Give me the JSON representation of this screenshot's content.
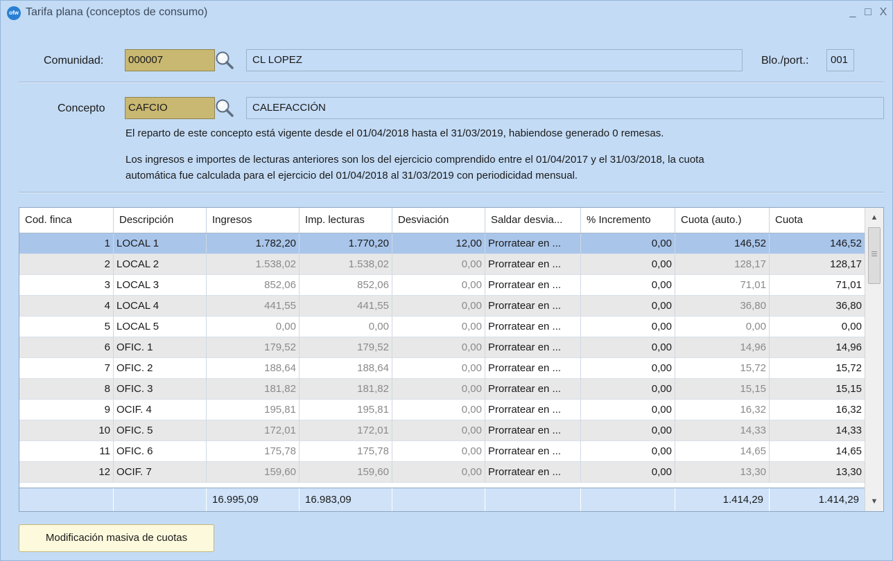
{
  "window": {
    "title": "Tarifa plana (conceptos de consumo)",
    "app_icon_text": "ofw",
    "controls": {
      "minimize": "_",
      "maximize": "□",
      "close": "X"
    }
  },
  "comunidad": {
    "label": "Comunidad:",
    "code": "000007",
    "name": "CL LOPEZ",
    "bloque_label": "Blo./port.:",
    "bloque_value": "001"
  },
  "concepto": {
    "label": "Concepto",
    "code": "CAFCIO",
    "name": "CALEFACCIÓN"
  },
  "info": {
    "line1": "El reparto de este concepto está vigente desde el 01/04/2018 hasta el 31/03/2019, habiendose generado 0 remesas.",
    "line2": "Los ingresos e importes de lecturas anteriores son los del ejercicio comprendido entre el 01/04/2017 y el 31/03/2018, la cuota",
    "line3": "automática fue calculada para el ejercicio del 01/04/2018 al 31/03/2019 con periodicidad mensual."
  },
  "grid": {
    "columns": [
      "Cod. finca",
      "Descripción",
      "Ingresos",
      "Imp. lecturas",
      "Desviación",
      "Saldar desvia...",
      "% Incremento",
      "Cuota (auto.)",
      "Cuota"
    ],
    "rows": [
      {
        "cod": "1",
        "desc": "LOCAL 1",
        "ing": "1.782,20",
        "imp": "1.770,20",
        "desv": "12,00",
        "saldar": "Prorratear en ...",
        "inc": "0,00",
        "auto": "146,52",
        "cuota": "146,52"
      },
      {
        "cod": "2",
        "desc": "LOCAL 2",
        "ing": "1.538,02",
        "imp": "1.538,02",
        "desv": "0,00",
        "saldar": "Prorratear en ...",
        "inc": "0,00",
        "auto": "128,17",
        "cuota": "128,17"
      },
      {
        "cod": "3",
        "desc": "LOCAL 3",
        "ing": "852,06",
        "imp": "852,06",
        "desv": "0,00",
        "saldar": "Prorratear en ...",
        "inc": "0,00",
        "auto": "71,01",
        "cuota": "71,01"
      },
      {
        "cod": "4",
        "desc": "LOCAL 4",
        "ing": "441,55",
        "imp": "441,55",
        "desv": "0,00",
        "saldar": "Prorratear en ...",
        "inc": "0,00",
        "auto": "36,80",
        "cuota": "36,80"
      },
      {
        "cod": "5",
        "desc": "LOCAL 5",
        "ing": "0,00",
        "imp": "0,00",
        "desv": "0,00",
        "saldar": "Prorratear en ...",
        "inc": "0,00",
        "auto": "0,00",
        "cuota": "0,00"
      },
      {
        "cod": "6",
        "desc": "OFIC. 1",
        "ing": "179,52",
        "imp": "179,52",
        "desv": "0,00",
        "saldar": "Prorratear en ...",
        "inc": "0,00",
        "auto": "14,96",
        "cuota": "14,96"
      },
      {
        "cod": "7",
        "desc": "OFIC. 2",
        "ing": "188,64",
        "imp": "188,64",
        "desv": "0,00",
        "saldar": "Prorratear en ...",
        "inc": "0,00",
        "auto": "15,72",
        "cuota": "15,72"
      },
      {
        "cod": "8",
        "desc": "OFIC. 3",
        "ing": "181,82",
        "imp": "181,82",
        "desv": "0,00",
        "saldar": "Prorratear en ...",
        "inc": "0,00",
        "auto": "15,15",
        "cuota": "15,15"
      },
      {
        "cod": "9",
        "desc": "OCIF. 4",
        "ing": "195,81",
        "imp": "195,81",
        "desv": "0,00",
        "saldar": "Prorratear en ...",
        "inc": "0,00",
        "auto": "16,32",
        "cuota": "16,32"
      },
      {
        "cod": "10",
        "desc": "OFIC. 5",
        "ing": "172,01",
        "imp": "172,01",
        "desv": "0,00",
        "saldar": "Prorratear en ...",
        "inc": "0,00",
        "auto": "14,33",
        "cuota": "14,33"
      },
      {
        "cod": "11",
        "desc": "OFIC. 6",
        "ing": "175,78",
        "imp": "175,78",
        "desv": "0,00",
        "saldar": "Prorratear en ...",
        "inc": "0,00",
        "auto": "14,65",
        "cuota": "14,65"
      },
      {
        "cod": "12",
        "desc": "OCIF. 7",
        "ing": "159,60",
        "imp": "159,60",
        "desv": "0,00",
        "saldar": "Prorratear en ...",
        "inc": "0,00",
        "auto": "13,30",
        "cuota": "13,30"
      }
    ],
    "totals": {
      "ingresos": "16.995,09",
      "imp_lecturas": "16.983,09",
      "cuota_auto": "1.414,29",
      "cuota": "1.414,29"
    },
    "selected_row": 0
  },
  "buttons": {
    "modificacion_masiva": "Modificación masiva de cuotas"
  },
  "colors": {
    "window_bg": "#c3dbf5",
    "code_field_bg": "#c9b872",
    "selected_row_bg": "#a9c5ea",
    "stripe_row_bg": "#e8e8e8",
    "button_bg": "#fcf9dc"
  }
}
